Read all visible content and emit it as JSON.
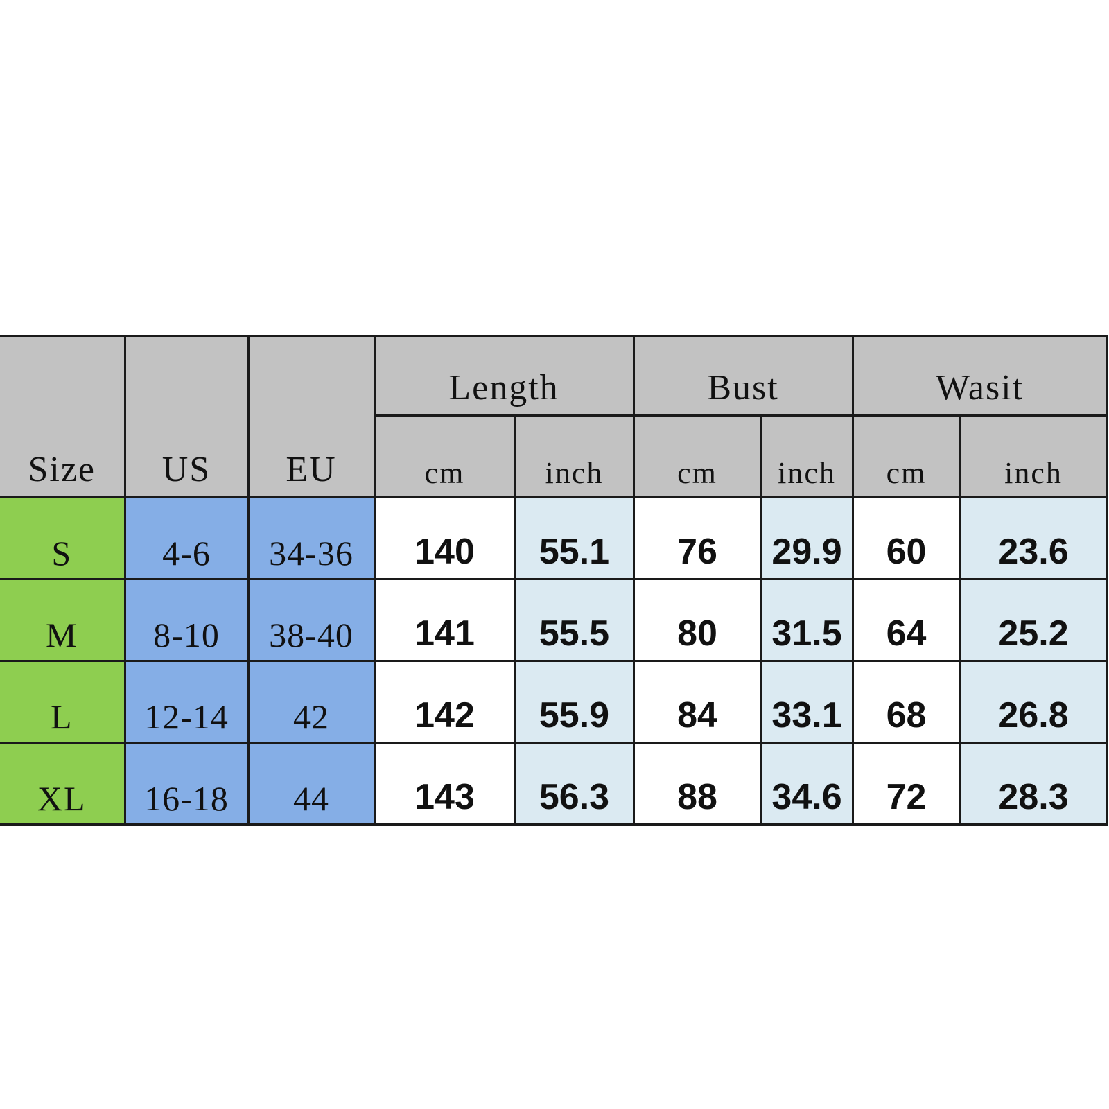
{
  "palette": {
    "header_bg": "#C2C2C2",
    "size_bg": "#8ECE50",
    "intl_bg": "#85AEE6",
    "cm_bg": "#FFFFFF",
    "inch_bg": "#DBEAF2",
    "border": "#1A1A1A",
    "text": "#111111",
    "page_bg": "#FFFFFF"
  },
  "chart_data": {
    "type": "table",
    "title": "",
    "headers": {
      "size": "Size",
      "us": "US",
      "eu": "EU",
      "groups": [
        {
          "label": "Length",
          "units": [
            "cm",
            "inch"
          ]
        },
        {
          "label": "Bust",
          "units": [
            "cm",
            "inch"
          ]
        },
        {
          "label": "Wasit",
          "units": [
            "cm",
            "inch"
          ]
        }
      ]
    },
    "columns": [
      "Size",
      "US",
      "EU",
      "Length cm",
      "Length inch",
      "Bust cm",
      "Bust inch",
      "Wasit cm",
      "Wasit inch"
    ],
    "rows": [
      {
        "size": "S",
        "us": "4-6",
        "eu": "34-36",
        "length_cm": "140",
        "length_inch": "55.1",
        "bust_cm": "76",
        "bust_inch": "29.9",
        "waist_cm": "60",
        "waist_inch": "23.6"
      },
      {
        "size": "M",
        "us": "8-10",
        "eu": "38-40",
        "length_cm": "141",
        "length_inch": "55.5",
        "bust_cm": "80",
        "bust_inch": "31.5",
        "waist_cm": "64",
        "waist_inch": "25.2"
      },
      {
        "size": "L",
        "us": "12-14",
        "eu": "42",
        "length_cm": "142",
        "length_inch": "55.9",
        "bust_cm": "84",
        "bust_inch": "33.1",
        "waist_cm": "68",
        "waist_inch": "26.8"
      },
      {
        "size": "XL",
        "us": "16-18",
        "eu": "44",
        "length_cm": "143",
        "length_inch": "56.3",
        "bust_cm": "88",
        "bust_inch": "34.6",
        "waist_cm": "72",
        "waist_inch": "28.3"
      }
    ]
  }
}
